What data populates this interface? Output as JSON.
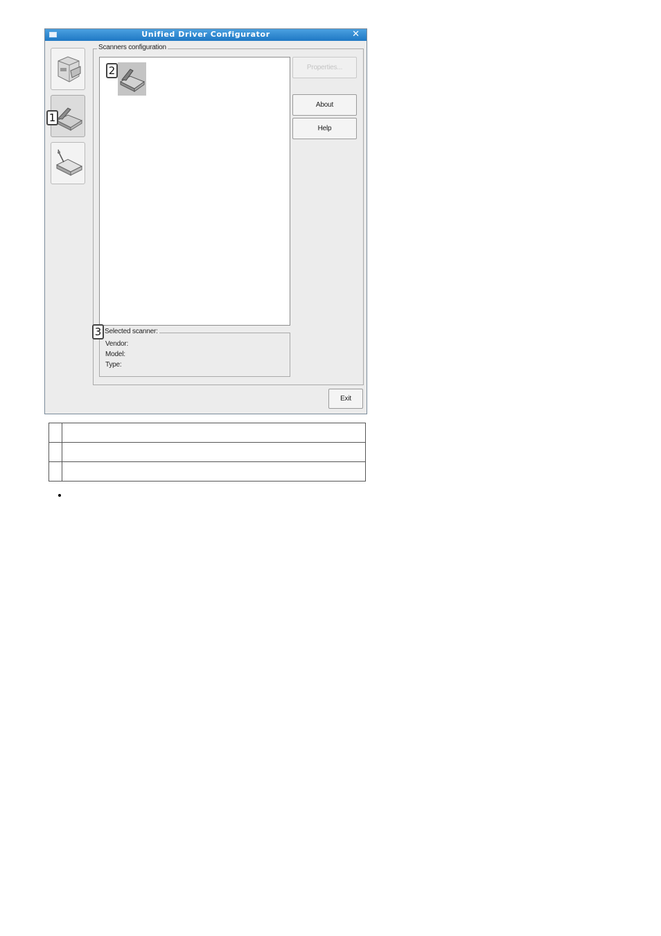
{
  "window": {
    "title": "Unified Driver Configurator",
    "close_glyph": "✕"
  },
  "nav": [
    {
      "icon": "printer-icon",
      "active": false
    },
    {
      "icon": "scanner-icon",
      "active": true
    },
    {
      "icon": "port-icon",
      "active": false
    }
  ],
  "scanners_group": {
    "label": "Scanners configuration"
  },
  "buttons": {
    "properties": "Properties...",
    "about": "About",
    "help": "Help",
    "exit": "Exit"
  },
  "selected_scanner": {
    "label": "Selected scanner:",
    "vendor_label": "Vendor:",
    "model_label": "Model:",
    "type_label": "Type:"
  },
  "callouts": {
    "one": "1",
    "two": "2",
    "three": "3"
  },
  "legend_rows": [
    {
      "num": "",
      "text": ""
    },
    {
      "num": "",
      "text": ""
    },
    {
      "num": "",
      "text": ""
    }
  ],
  "colors": {
    "titlebar": "#2a86d0",
    "window_bg": "#ececec"
  }
}
